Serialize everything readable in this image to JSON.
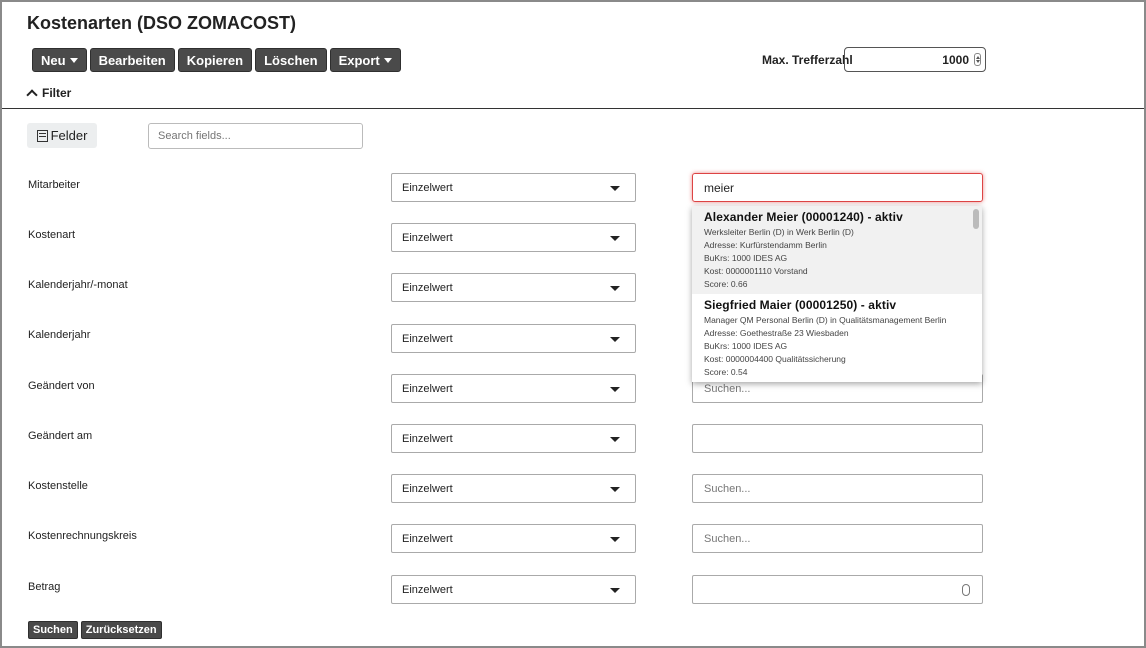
{
  "page": {
    "title": "Kostenarten (DSO ZOMACOST)"
  },
  "toolbar": {
    "new_label": "Neu",
    "edit_label": "Bearbeiten",
    "copy_label": "Kopieren",
    "delete_label": "Löschen",
    "export_label": "Export"
  },
  "max_hits": {
    "label": "Max. Trefferzahl",
    "value": "1000"
  },
  "filter": {
    "toggle_label": "Filter"
  },
  "fields": {
    "felder_label": "Felder",
    "search_placeholder": "Search fields..."
  },
  "rows": [
    {
      "label": "Mitarbeiter",
      "mode": "Einzelwert",
      "value": "meier",
      "placeholder": ""
    },
    {
      "label": "Kostenart",
      "mode": "Einzelwert",
      "value": "",
      "placeholder": ""
    },
    {
      "label": "Kalenderjahr/-monat",
      "mode": "Einzelwert",
      "value": "",
      "placeholder": ""
    },
    {
      "label": "Kalenderjahr",
      "mode": "Einzelwert",
      "value": "",
      "placeholder": ""
    },
    {
      "label": "Geändert von",
      "mode": "Einzelwert",
      "value": "",
      "placeholder": "Suchen..."
    },
    {
      "label": "Geändert am",
      "mode": "Einzelwert",
      "value": "",
      "placeholder": ""
    },
    {
      "label": "Kostenstelle",
      "mode": "Einzelwert",
      "value": "",
      "placeholder": "Suchen..."
    },
    {
      "label": "Kostenrechnungskreis",
      "mode": "Einzelwert",
      "value": "",
      "placeholder": "Suchen..."
    },
    {
      "label": "Betrag",
      "mode": "Einzelwert",
      "value": "",
      "placeholder": ""
    }
  ],
  "suggestions": [
    {
      "name": "Alexander Meier (00001240) - aktiv",
      "line1": "Werksleiter Berlin (D) in Werk Berlin (D)",
      "line2": "Adresse: Kurfürstendamm Berlin",
      "line3": "BuKrs: 1000 IDES AG",
      "line4": "Kost: 0000001110 Vorstand",
      "line5": "Score: 0.66"
    },
    {
      "name": "Siegfried Maier (00001250) - aktiv",
      "line1": "Manager QM Personal Berlin (D) in Qualitätsmanagement Berlin",
      "line2": "Adresse: Goethestraße 23 Wiesbaden",
      "line3": "BuKrs: 1000 IDES AG",
      "line4": "Kost: 0000004400 Qualitätssicherung",
      "line5": "Score: 0.54"
    }
  ],
  "actions": {
    "search_label": "Suchen",
    "reset_label": "Zurücksetzen"
  }
}
